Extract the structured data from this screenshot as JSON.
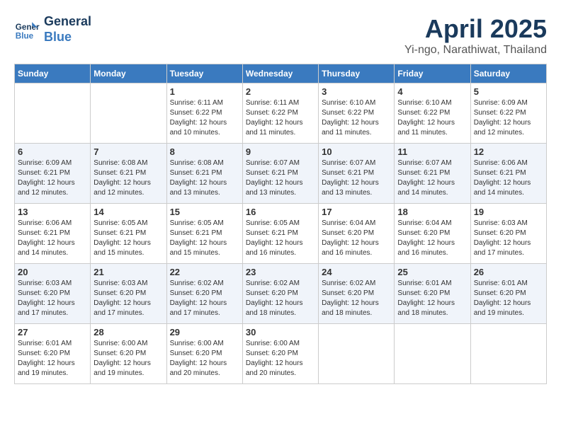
{
  "header": {
    "logo_line1": "General",
    "logo_line2": "Blue",
    "month": "April 2025",
    "location": "Yi-ngo, Narathiwat, Thailand"
  },
  "weekdays": [
    "Sunday",
    "Monday",
    "Tuesday",
    "Wednesday",
    "Thursday",
    "Friday",
    "Saturday"
  ],
  "weeks": [
    [
      {
        "day": "",
        "info": ""
      },
      {
        "day": "",
        "info": ""
      },
      {
        "day": "1",
        "info": "Sunrise: 6:11 AM\nSunset: 6:22 PM\nDaylight: 12 hours\nand 10 minutes."
      },
      {
        "day": "2",
        "info": "Sunrise: 6:11 AM\nSunset: 6:22 PM\nDaylight: 12 hours\nand 11 minutes."
      },
      {
        "day": "3",
        "info": "Sunrise: 6:10 AM\nSunset: 6:22 PM\nDaylight: 12 hours\nand 11 minutes."
      },
      {
        "day": "4",
        "info": "Sunrise: 6:10 AM\nSunset: 6:22 PM\nDaylight: 12 hours\nand 11 minutes."
      },
      {
        "day": "5",
        "info": "Sunrise: 6:09 AM\nSunset: 6:22 PM\nDaylight: 12 hours\nand 12 minutes."
      }
    ],
    [
      {
        "day": "6",
        "info": "Sunrise: 6:09 AM\nSunset: 6:21 PM\nDaylight: 12 hours\nand 12 minutes."
      },
      {
        "day": "7",
        "info": "Sunrise: 6:08 AM\nSunset: 6:21 PM\nDaylight: 12 hours\nand 12 minutes."
      },
      {
        "day": "8",
        "info": "Sunrise: 6:08 AM\nSunset: 6:21 PM\nDaylight: 12 hours\nand 13 minutes."
      },
      {
        "day": "9",
        "info": "Sunrise: 6:07 AM\nSunset: 6:21 PM\nDaylight: 12 hours\nand 13 minutes."
      },
      {
        "day": "10",
        "info": "Sunrise: 6:07 AM\nSunset: 6:21 PM\nDaylight: 12 hours\nand 13 minutes."
      },
      {
        "day": "11",
        "info": "Sunrise: 6:07 AM\nSunset: 6:21 PM\nDaylight: 12 hours\nand 14 minutes."
      },
      {
        "day": "12",
        "info": "Sunrise: 6:06 AM\nSunset: 6:21 PM\nDaylight: 12 hours\nand 14 minutes."
      }
    ],
    [
      {
        "day": "13",
        "info": "Sunrise: 6:06 AM\nSunset: 6:21 PM\nDaylight: 12 hours\nand 14 minutes."
      },
      {
        "day": "14",
        "info": "Sunrise: 6:05 AM\nSunset: 6:21 PM\nDaylight: 12 hours\nand 15 minutes."
      },
      {
        "day": "15",
        "info": "Sunrise: 6:05 AM\nSunset: 6:21 PM\nDaylight: 12 hours\nand 15 minutes."
      },
      {
        "day": "16",
        "info": "Sunrise: 6:05 AM\nSunset: 6:21 PM\nDaylight: 12 hours\nand 16 minutes."
      },
      {
        "day": "17",
        "info": "Sunrise: 6:04 AM\nSunset: 6:20 PM\nDaylight: 12 hours\nand 16 minutes."
      },
      {
        "day": "18",
        "info": "Sunrise: 6:04 AM\nSunset: 6:20 PM\nDaylight: 12 hours\nand 16 minutes."
      },
      {
        "day": "19",
        "info": "Sunrise: 6:03 AM\nSunset: 6:20 PM\nDaylight: 12 hours\nand 17 minutes."
      }
    ],
    [
      {
        "day": "20",
        "info": "Sunrise: 6:03 AM\nSunset: 6:20 PM\nDaylight: 12 hours\nand 17 minutes."
      },
      {
        "day": "21",
        "info": "Sunrise: 6:03 AM\nSunset: 6:20 PM\nDaylight: 12 hours\nand 17 minutes."
      },
      {
        "day": "22",
        "info": "Sunrise: 6:02 AM\nSunset: 6:20 PM\nDaylight: 12 hours\nand 17 minutes."
      },
      {
        "day": "23",
        "info": "Sunrise: 6:02 AM\nSunset: 6:20 PM\nDaylight: 12 hours\nand 18 minutes."
      },
      {
        "day": "24",
        "info": "Sunrise: 6:02 AM\nSunset: 6:20 PM\nDaylight: 12 hours\nand 18 minutes."
      },
      {
        "day": "25",
        "info": "Sunrise: 6:01 AM\nSunset: 6:20 PM\nDaylight: 12 hours\nand 18 minutes."
      },
      {
        "day": "26",
        "info": "Sunrise: 6:01 AM\nSunset: 6:20 PM\nDaylight: 12 hours\nand 19 minutes."
      }
    ],
    [
      {
        "day": "27",
        "info": "Sunrise: 6:01 AM\nSunset: 6:20 PM\nDaylight: 12 hours\nand 19 minutes."
      },
      {
        "day": "28",
        "info": "Sunrise: 6:00 AM\nSunset: 6:20 PM\nDaylight: 12 hours\nand 19 minutes."
      },
      {
        "day": "29",
        "info": "Sunrise: 6:00 AM\nSunset: 6:20 PM\nDaylight: 12 hours\nand 20 minutes."
      },
      {
        "day": "30",
        "info": "Sunrise: 6:00 AM\nSunset: 6:20 PM\nDaylight: 12 hours\nand 20 minutes."
      },
      {
        "day": "",
        "info": ""
      },
      {
        "day": "",
        "info": ""
      },
      {
        "day": "",
        "info": ""
      }
    ]
  ]
}
